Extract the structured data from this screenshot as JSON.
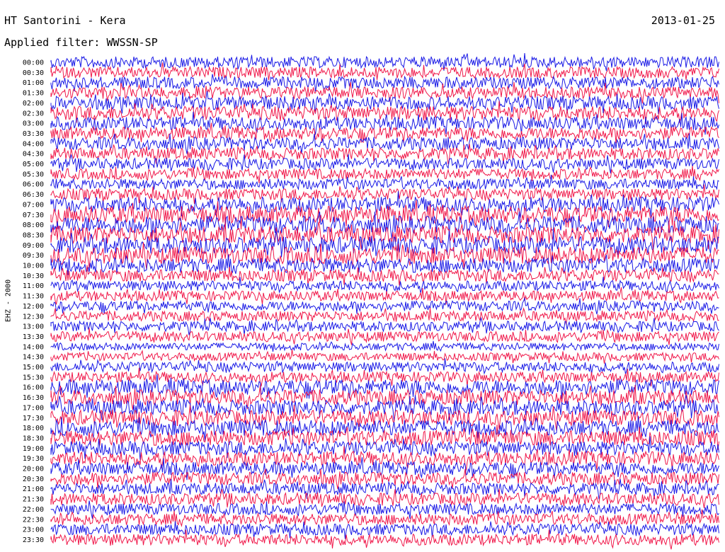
{
  "header": {
    "title": "HT Santorini - Kera",
    "date": "2013-01-25",
    "filter": "Applied filter: WWSSN-SP"
  },
  "chart_data": {
    "type": "line",
    "title": "HT Santorini - Kera",
    "subtitle": "Applied filter: WWSSN-SP",
    "ylabel": "EHZ - 2000",
    "colors": [
      "#1a1ae6",
      "#f0184a"
    ],
    "rows": [
      {
        "label": "00:00",
        "activity": 0.55
      },
      {
        "label": "00:30",
        "activity": 0.55
      },
      {
        "label": "01:00",
        "activity": 0.6
      },
      {
        "label": "01:30",
        "activity": 0.6
      },
      {
        "label": "02:00",
        "activity": 0.7
      },
      {
        "label": "02:30",
        "activity": 0.75
      },
      {
        "label": "03:00",
        "activity": 0.7
      },
      {
        "label": "03:30",
        "activity": 0.65
      },
      {
        "label": "04:00",
        "activity": 0.65
      },
      {
        "label": "04:30",
        "activity": 0.6
      },
      {
        "label": "05:00",
        "activity": 0.55
      },
      {
        "label": "05:30",
        "activity": 0.5
      },
      {
        "label": "06:00",
        "activity": 0.5
      },
      {
        "label": "06:30",
        "activity": 0.55
      },
      {
        "label": "07:00",
        "activity": 0.85
      },
      {
        "label": "07:30",
        "activity": 1.0
      },
      {
        "label": "08:00",
        "activity": 1.0
      },
      {
        "label": "08:30",
        "activity": 1.0
      },
      {
        "label": "09:00",
        "activity": 1.0
      },
      {
        "label": "09:30",
        "activity": 1.0
      },
      {
        "label": "10:00",
        "activity": 0.8
      },
      {
        "label": "10:30",
        "activity": 0.6
      },
      {
        "label": "11:00",
        "activity": 0.45
      },
      {
        "label": "11:30",
        "activity": 0.45
      },
      {
        "label": "12:00",
        "activity": 0.45
      },
      {
        "label": "12:30",
        "activity": 0.45
      },
      {
        "label": "13:00",
        "activity": 0.45
      },
      {
        "label": "13:30",
        "activity": 0.45
      },
      {
        "label": "14:00",
        "activity": 0.25
      },
      {
        "label": "14:30",
        "activity": 0.3
      },
      {
        "label": "15:00",
        "activity": 0.45
      },
      {
        "label": "15:30",
        "activity": 0.5
      },
      {
        "label": "16:00",
        "activity": 0.85
      },
      {
        "label": "16:30",
        "activity": 0.85
      },
      {
        "label": "17:00",
        "activity": 0.85
      },
      {
        "label": "17:30",
        "activity": 0.85
      },
      {
        "label": "18:00",
        "activity": 0.9
      },
      {
        "label": "18:30",
        "activity": 0.85
      },
      {
        "label": "19:00",
        "activity": 0.75
      },
      {
        "label": "19:30",
        "activity": 0.75
      },
      {
        "label": "20:00",
        "activity": 0.7
      },
      {
        "label": "20:30",
        "activity": 0.65
      },
      {
        "label": "21:00",
        "activity": 0.6
      },
      {
        "label": "21:30",
        "activity": 0.6
      },
      {
        "label": "22:00",
        "activity": 0.55
      },
      {
        "label": "22:30",
        "activity": 0.55
      },
      {
        "label": "23:00",
        "activity": 0.55
      },
      {
        "label": "23:30",
        "activity": 0.55
      }
    ]
  }
}
